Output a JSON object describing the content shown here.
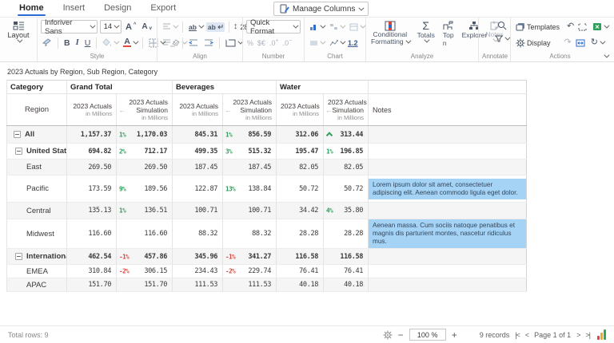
{
  "menu": {
    "tabs": [
      "Home",
      "Insert",
      "Design",
      "Export"
    ],
    "active_tab": "Home",
    "manage_columns": "Manage Columns"
  },
  "ribbon": {
    "layout": {
      "label": "Layout"
    },
    "style": {
      "label": "Style",
      "font_name": "Inforiver Sans",
      "font_size": "14",
      "bold": "B",
      "italic": "I",
      "underline": "U"
    },
    "align": {
      "label": "Align",
      "wrap": "ab",
      "orient": "ab",
      "row_height": "28"
    },
    "number": {
      "label": "Number",
      "quick_format": "Quick Format",
      "percent": "%",
      "currency": "$€",
      "inc_decimal": ".0",
      "dec_decimal": ".0"
    },
    "chart": {
      "label": "Chart",
      "number_format": "1.2"
    },
    "analyze": {
      "label": "Analyze",
      "conditional_formatting_1": "Conditional",
      "conditional_formatting_2": "Formatting",
      "totals": "Totals",
      "top_n": "Top n",
      "explorer": "Explorer"
    },
    "annotate": {
      "label": "Annotate",
      "notes": "Notes"
    },
    "actions": {
      "label": "Actions",
      "templates": "Templates",
      "display": "Display"
    }
  },
  "report": {
    "title": "2023 Actuals by Region, Sub Region, Category"
  },
  "table": {
    "corner": "Category",
    "row_dim": "Region",
    "notes_header": "Notes",
    "groups": [
      "Grand Total",
      "Beverages",
      "Water"
    ],
    "actuals_header": {
      "line1": "2023 Actuals",
      "line2": "in Millions"
    },
    "simulation_header": {
      "line1": "2023 Actuals",
      "line2": "Simulation",
      "line3": "in Millions"
    },
    "rows": [
      {
        "label": "All",
        "level": 0,
        "expandable": true,
        "bold": true,
        "shade": true,
        "gt_act": "1,157.37",
        "gt_pct": "1%",
        "gt_sim": "1,170.03",
        "bev_act": "845.31",
        "bev_pct": "1%",
        "bev_sim": "856.59",
        "wat_act": "312.06",
        "wat_pct": "^",
        "wat_sim": "313.44",
        "note": ""
      },
      {
        "label": "United States",
        "level": 1,
        "expandable": true,
        "bold": true,
        "shade": false,
        "gt_act": "694.82",
        "gt_pct": "2%",
        "gt_sim": "712.17",
        "bev_act": "499.35",
        "bev_pct": "3%",
        "bev_sim": "515.32",
        "wat_act": "195.47",
        "wat_pct": "1%",
        "wat_sim": "196.85",
        "note": ""
      },
      {
        "label": "East",
        "level": 2,
        "expandable": false,
        "bold": false,
        "shade": true,
        "gt_act": "269.50",
        "gt_pct": "",
        "gt_sim": "269.50",
        "bev_act": "187.45",
        "bev_pct": "",
        "bev_sim": "187.45",
        "wat_act": "82.05",
        "wat_pct": "",
        "wat_sim": "82.05",
        "note": ""
      },
      {
        "label": "Pacific",
        "level": 2,
        "expandable": false,
        "bold": false,
        "shade": false,
        "gt_act": "173.59",
        "gt_pct": "9%",
        "gt_sim": "189.56",
        "bev_act": "122.87",
        "bev_pct": "13%",
        "bev_sim": "138.84",
        "wat_act": "50.72",
        "wat_pct": "",
        "wat_sim": "50.72",
        "note": "Lorem ipsum dolor sit amet, consectetuer adipiscing elit. Aenean commodo ligula eget dolor."
      },
      {
        "label": "Central",
        "level": 2,
        "expandable": false,
        "bold": false,
        "shade": true,
        "gt_act": "135.13",
        "gt_pct": "1%",
        "gt_sim": "136.51",
        "bev_act": "100.71",
        "bev_pct": "",
        "bev_sim": "100.71",
        "wat_act": "34.42",
        "wat_pct": "4%",
        "wat_sim": "35.80",
        "note": ""
      },
      {
        "label": "Midwest",
        "level": 2,
        "expandable": false,
        "bold": false,
        "shade": false,
        "gt_act": "116.60",
        "gt_pct": "",
        "gt_sim": "116.60",
        "bev_act": "88.32",
        "bev_pct": "",
        "bev_sim": "88.32",
        "wat_act": "28.28",
        "wat_pct": "",
        "wat_sim": "28.28",
        "note": "Aenean massa. Cum sociis natoque penatibus et magnis dis parturient montes, nascetur ridiculus mus."
      },
      {
        "label": "International",
        "level": 1,
        "expandable": true,
        "bold": true,
        "shade": true,
        "gt_act": "462.54",
        "gt_pct": "-1%",
        "gt_sim": "457.86",
        "bev_act": "345.96",
        "bev_pct": "-1%",
        "bev_sim": "341.27",
        "wat_act": "116.58",
        "wat_pct": "",
        "wat_sim": "116.58",
        "note": ""
      },
      {
        "label": "EMEA",
        "level": 2,
        "expandable": false,
        "bold": false,
        "shade": false,
        "gt_act": "310.84",
        "gt_pct": "-2%",
        "gt_sim": "306.15",
        "bev_act": "234.43",
        "bev_pct": "-2%",
        "bev_sim": "229.74",
        "wat_act": "76.41",
        "wat_pct": "",
        "wat_sim": "76.41",
        "note": ""
      },
      {
        "label": "APAC",
        "level": 2,
        "expandable": false,
        "bold": false,
        "shade": true,
        "gt_act": "151.70",
        "gt_pct": "",
        "gt_sim": "151.70",
        "bev_act": "111.53",
        "bev_pct": "",
        "bev_sim": "111.53",
        "wat_act": "40.18",
        "wat_pct": "",
        "wat_sim": "40.18",
        "note": ""
      }
    ]
  },
  "status": {
    "total_rows": "Total rows: 9",
    "zoom": "100 %",
    "records": "9 records",
    "page": "Page 1 of 1"
  },
  "colors": {
    "accent": "#2b6cd4",
    "positive": "#2f9e5b",
    "negative": "#d9453c",
    "note_bg": "#a5d3f6"
  }
}
